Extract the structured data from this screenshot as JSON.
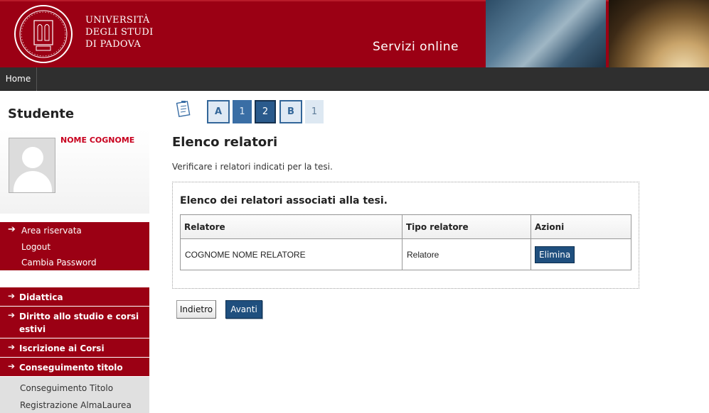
{
  "header": {
    "university_lines": [
      "UNIVERSITÀ",
      "DEGLI STUDI",
      "DI PADOVA"
    ],
    "service_title": "Servizi online"
  },
  "nav": {
    "home": "Home"
  },
  "sidebar": {
    "title": "Studente",
    "student_name": "NOME COGNOME",
    "area": {
      "label": "Area riservata",
      "items": [
        "Logout",
        "Cambia Password"
      ]
    },
    "menu": [
      {
        "label": "Didattica"
      },
      {
        "label": "Diritto allo studio e corsi estivi"
      },
      {
        "label": "Iscrizione ai Corsi"
      },
      {
        "label": "Conseguimento titolo"
      }
    ],
    "submenu": [
      "Conseguimento Titolo",
      "Registrazione AlmaLaurea"
    ]
  },
  "steps": [
    {
      "label": "A",
      "state": "outline"
    },
    {
      "label": "1",
      "state": "done"
    },
    {
      "label": "2",
      "state": "active"
    },
    {
      "label": "B",
      "state": "outline"
    },
    {
      "label": "1",
      "state": "pending"
    }
  ],
  "main": {
    "title": "Elenco relatori",
    "description": "Verificare i relatori indicati per la tesi.",
    "panel_title": "Elenco dei relatori associati alla tesi.",
    "table": {
      "headers": [
        "Relatore",
        "Tipo relatore",
        "Azioni"
      ],
      "rows": [
        {
          "relatore": "COGNOME NOME RELATORE",
          "tipo": "Relatore",
          "azione": "Elimina"
        }
      ]
    },
    "buttons": {
      "back": "Indietro",
      "next": "Avanti"
    }
  },
  "colors": {
    "brand_red": "#9b0014",
    "nav_dark": "#2f2f2f",
    "accent_blue": "#1f4f7e",
    "name_red": "#c8001e"
  },
  "icons": {
    "seal": "university-seal-icon",
    "steps": "checklist-icon",
    "arrow": "right-arrow-icon"
  }
}
